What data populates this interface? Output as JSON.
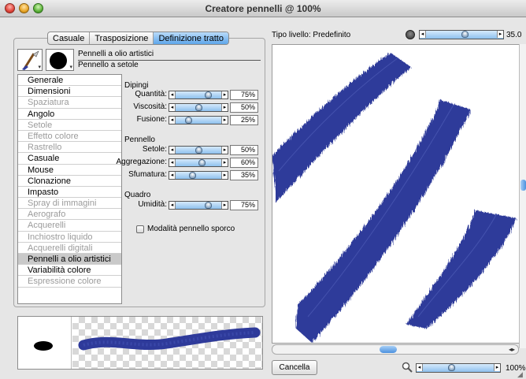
{
  "window": {
    "title": "Creatore pennelli @ 100%"
  },
  "tabs": [
    {
      "label": "Casuale",
      "active": false
    },
    {
      "label": "Trasposizione",
      "active": false
    },
    {
      "label": "Definizione tratto",
      "active": true
    }
  ],
  "brush": {
    "category": "Pennelli a olio artistici",
    "variant": "Pennello a setole"
  },
  "properties": [
    {
      "label": "Generale",
      "state": "enabled"
    },
    {
      "label": "Dimensioni",
      "state": "enabled"
    },
    {
      "label": "Spaziatura",
      "state": "disabled"
    },
    {
      "label": "Angolo",
      "state": "enabled"
    },
    {
      "label": "Setole",
      "state": "disabled"
    },
    {
      "label": "Effetto colore",
      "state": "disabled"
    },
    {
      "label": "Rastrello",
      "state": "disabled"
    },
    {
      "label": "Casuale",
      "state": "enabled"
    },
    {
      "label": "Mouse",
      "state": "enabled"
    },
    {
      "label": "Clonazione",
      "state": "enabled"
    },
    {
      "label": "Impasto",
      "state": "enabled"
    },
    {
      "label": "Spray di immagini",
      "state": "disabled"
    },
    {
      "label": "Aerografo",
      "state": "disabled"
    },
    {
      "label": "Acquerelli",
      "state": "disabled"
    },
    {
      "label": "Inchiostro liquido",
      "state": "disabled"
    },
    {
      "label": "Acquerelli digitali",
      "state": "disabled"
    },
    {
      "label": "Pennelli a olio artistici",
      "state": "selected"
    },
    {
      "label": "Variabilità colore",
      "state": "enabled"
    },
    {
      "label": "Espressione colore",
      "state": "disabled"
    }
  ],
  "sections": {
    "dipingi": {
      "title": "Dipingi",
      "quantita": {
        "label": "Quantità:",
        "value": "75%",
        "level": 0.75
      },
      "viscosita": {
        "label": "Viscosità:",
        "value": "50%",
        "level": 0.5
      },
      "fusione": {
        "label": "Fusione:",
        "value": "25%",
        "level": 0.25
      }
    },
    "pennello": {
      "title": "Pennello",
      "setole": {
        "label": "Setole:",
        "value": "50%",
        "level": 0.5
      },
      "aggregazione": {
        "label": "Aggregazione:",
        "value": "60%",
        "level": 0.6
      },
      "sfumatura": {
        "label": "Sfumatura:",
        "value": "35%",
        "level": 0.35
      }
    },
    "quadro": {
      "title": "Quadro",
      "umidita": {
        "label": "Umidità:",
        "value": "75%",
        "level": 0.75
      }
    }
  },
  "dirty_mode": {
    "label": "Modalità pennello sporco",
    "checked": false
  },
  "layer": {
    "type_label": "Tipo livello: Predefinito",
    "size_value": "35.0",
    "size_level": 0.55
  },
  "buttons": {
    "cancel": "Cancella"
  },
  "zoom": {
    "value": "100%",
    "level": 0.4
  },
  "colors": {
    "stroke": "#2e3a9a",
    "accent": "#5ea6ea"
  }
}
